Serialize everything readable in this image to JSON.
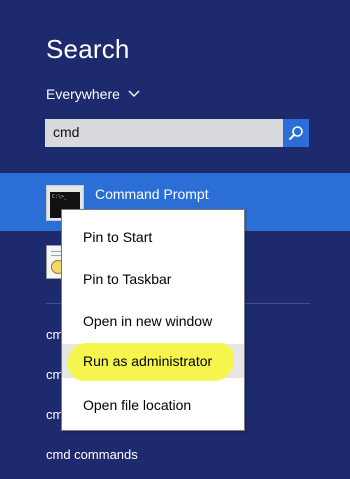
{
  "header": {
    "title": "Search",
    "scope": "Everywhere"
  },
  "search": {
    "value": "cmd"
  },
  "results": {
    "selected_label": "Command Prompt"
  },
  "suggestions": [
    {
      "prefix": "cm",
      "rest": ""
    },
    {
      "prefix": "cm",
      "rest": ""
    },
    {
      "prefix": "cm",
      "rest": ""
    },
    {
      "prefix": "cmd",
      "rest": " commands"
    }
  ],
  "context_menu": {
    "items": [
      "Pin to Start",
      "Pin to Taskbar",
      "Open in new window",
      "Run as administrator",
      "Open file location"
    ],
    "highlighted_index": 3
  },
  "colors": {
    "background": "#1e2a6e",
    "selection": "#2b6fd6",
    "highlighter": "#f5f545"
  },
  "icons": {
    "scope": "chevron-down-icon",
    "search_button": "search-icon",
    "result1": "command-prompt-icon",
    "result2": "certificate-document-icon"
  }
}
